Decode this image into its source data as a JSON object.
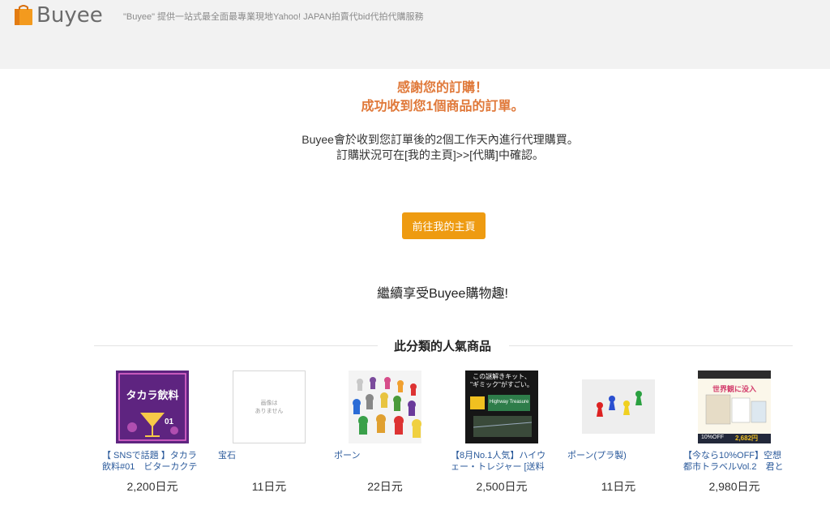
{
  "header": {
    "logo_text": "Buyee",
    "tagline": "\"Buyee\" 提供一站式最全面最專業現地Yahoo! JAPAN拍賣代bid代拍代購服務"
  },
  "confirmation": {
    "thanks_line1": "感謝您的訂購！",
    "thanks_line2": "成功收到您1個商品的訂單。",
    "info_line1": "Buyee會於收到您訂單後的2個工作天內進行代理購買。",
    "info_line2": "訂購狀況可在[我的主頁]>>[代購]中確認。",
    "button_label": "前往我的主頁",
    "enjoy_text": "繼續享受Buyee購物趣!"
  },
  "popular": {
    "title": "此分類的人氣商品",
    "items": [
      {
        "name": "【 SNSで話題 】タカラ飲料#01　ビターカクテ",
        "price": "2,200日元",
        "image_text": [
          "タカラ飲料",
          "01"
        ]
      },
      {
        "name": "宝石",
        "price": "11日元",
        "image_text": [
          "画像は",
          "ありません"
        ]
      },
      {
        "name": "ポーン",
        "price": "22日元",
        "image_text": []
      },
      {
        "name": "【8月No.1人気】ハイウェー・トレジャー [送料",
        "price": "2,500日元",
        "image_text": [
          "この謎解きキット、",
          "\"ギミック\"がすごい。",
          "Highway Treasure"
        ]
      },
      {
        "name": "ポーン(プラ製)",
        "price": "11日元",
        "image_text": []
      },
      {
        "name": "【今なら10%OFF】空想都市トラベルVol.2　君と",
        "price": "2,980日元",
        "image_text": [
          "世界観に没入",
          "10%OFF",
          "2,682円"
        ]
      }
    ]
  },
  "colors": {
    "accent_orange": "#ee9b11",
    "thanks_orange": "#e0793a",
    "link_blue": "#2b5a9b"
  }
}
